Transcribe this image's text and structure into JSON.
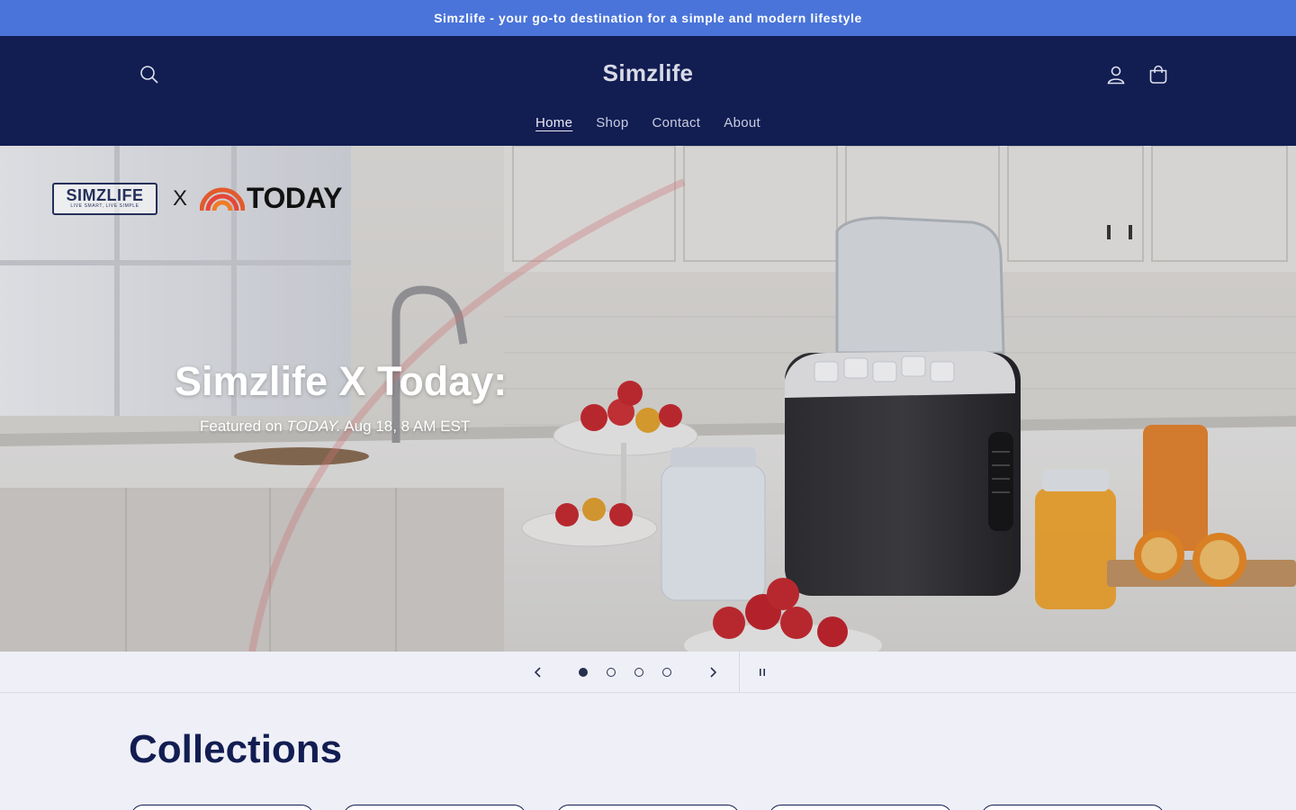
{
  "announcement": {
    "text": "Simzlife - your go-to destination for a simple and modern lifestyle"
  },
  "header": {
    "logo": "Simzlife",
    "search_icon": "search-icon",
    "account_icon": "user-icon",
    "cart_icon": "cart-icon",
    "nav": [
      {
        "label": "Home",
        "active": true
      },
      {
        "label": "Shop",
        "active": false
      },
      {
        "label": "Contact",
        "active": false
      },
      {
        "label": "About",
        "active": false
      }
    ]
  },
  "hero": {
    "brand_simz": "SIMZLIFE",
    "brand_tagline": "LIVE SMART, LIVE SIMPLE",
    "brand_x": "X",
    "brand_today": "TODAY",
    "title": "Simzlife X Today:",
    "subtitle_prefix": "Featured on ",
    "subtitle_show": "TODAY.",
    "subtitle_suffix": " Aug 18, 8 AM EST"
  },
  "slider": {
    "prev_icon": "chevron-left-icon",
    "next_icon": "chevron-right-icon",
    "pause_icon": "pause-icon",
    "slide_count": 4,
    "active_slide": 1
  },
  "collections": {
    "title": "Collections",
    "card_count": 5
  },
  "colors": {
    "announcement_bg": "#4a74d9",
    "header_bg": "#121d52",
    "page_bg": "#eff0f7",
    "heading": "#121d52"
  }
}
